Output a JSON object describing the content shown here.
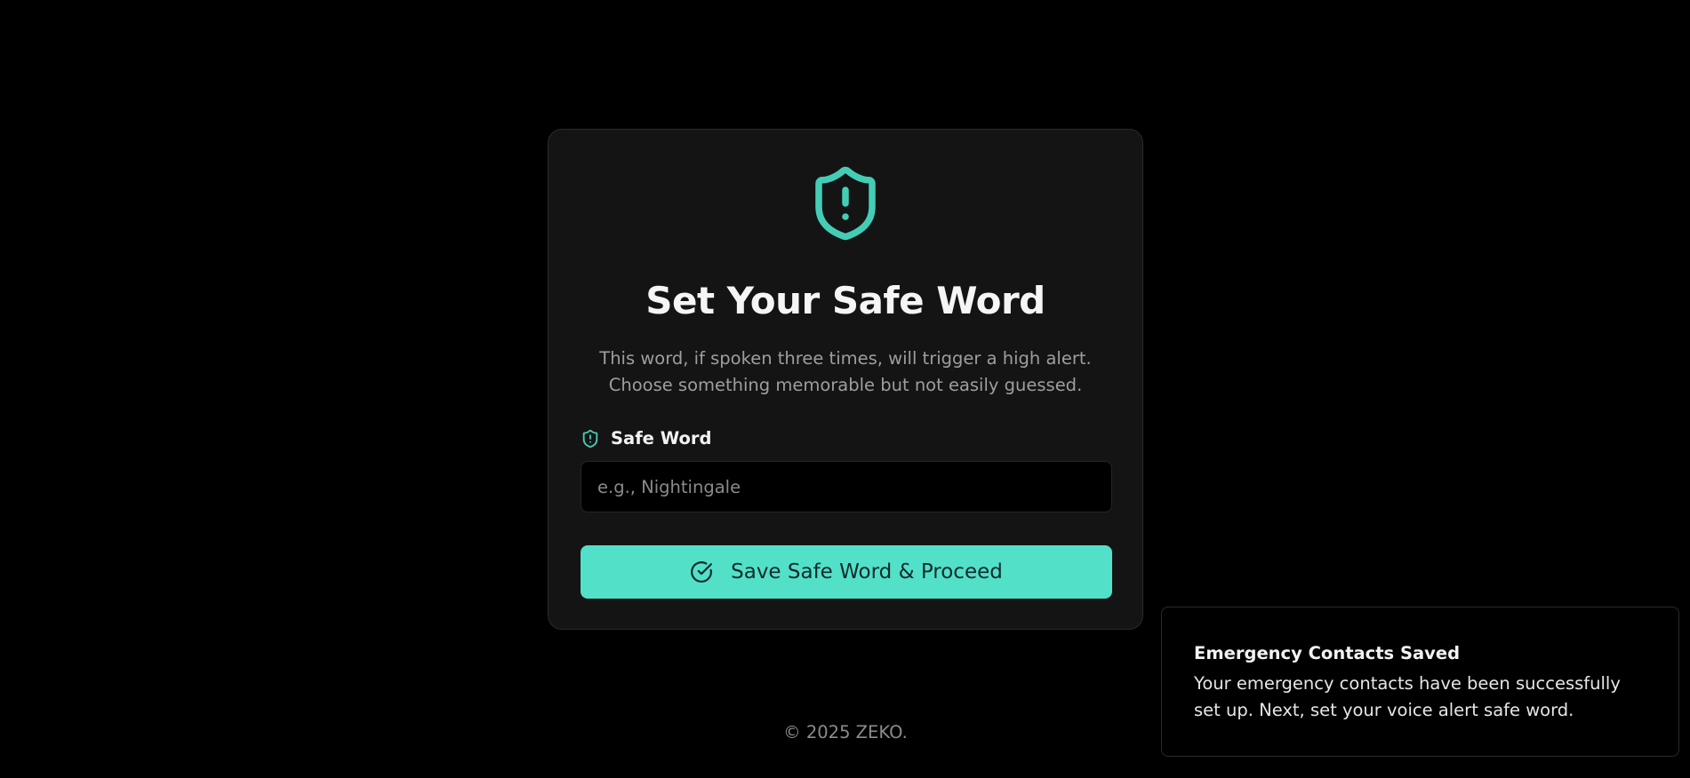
{
  "card": {
    "title": "Set Your Safe Word",
    "subtitle": "This word, if spoken three times, will trigger a high alert. Choose something memorable but not easily guessed.",
    "hero_icon": "shield-alert-icon",
    "field": {
      "label": "Safe Word",
      "icon": "shield-alert-icon",
      "value": "",
      "placeholder": "e.g., Nightingale"
    },
    "submit": {
      "label": "Save Safe Word & Proceed",
      "icon": "check-circle-icon"
    }
  },
  "footer": {
    "text": "© 2025 ZEKO."
  },
  "toast": {
    "title": "Emergency Contacts Saved",
    "body": "Your emergency contacts have been successfully set up. Next, set your voice alert safe word."
  },
  "colors": {
    "accent": "#52e0c8",
    "background": "#000000",
    "card": "#141414",
    "muted_text": "#9e9e9e"
  }
}
